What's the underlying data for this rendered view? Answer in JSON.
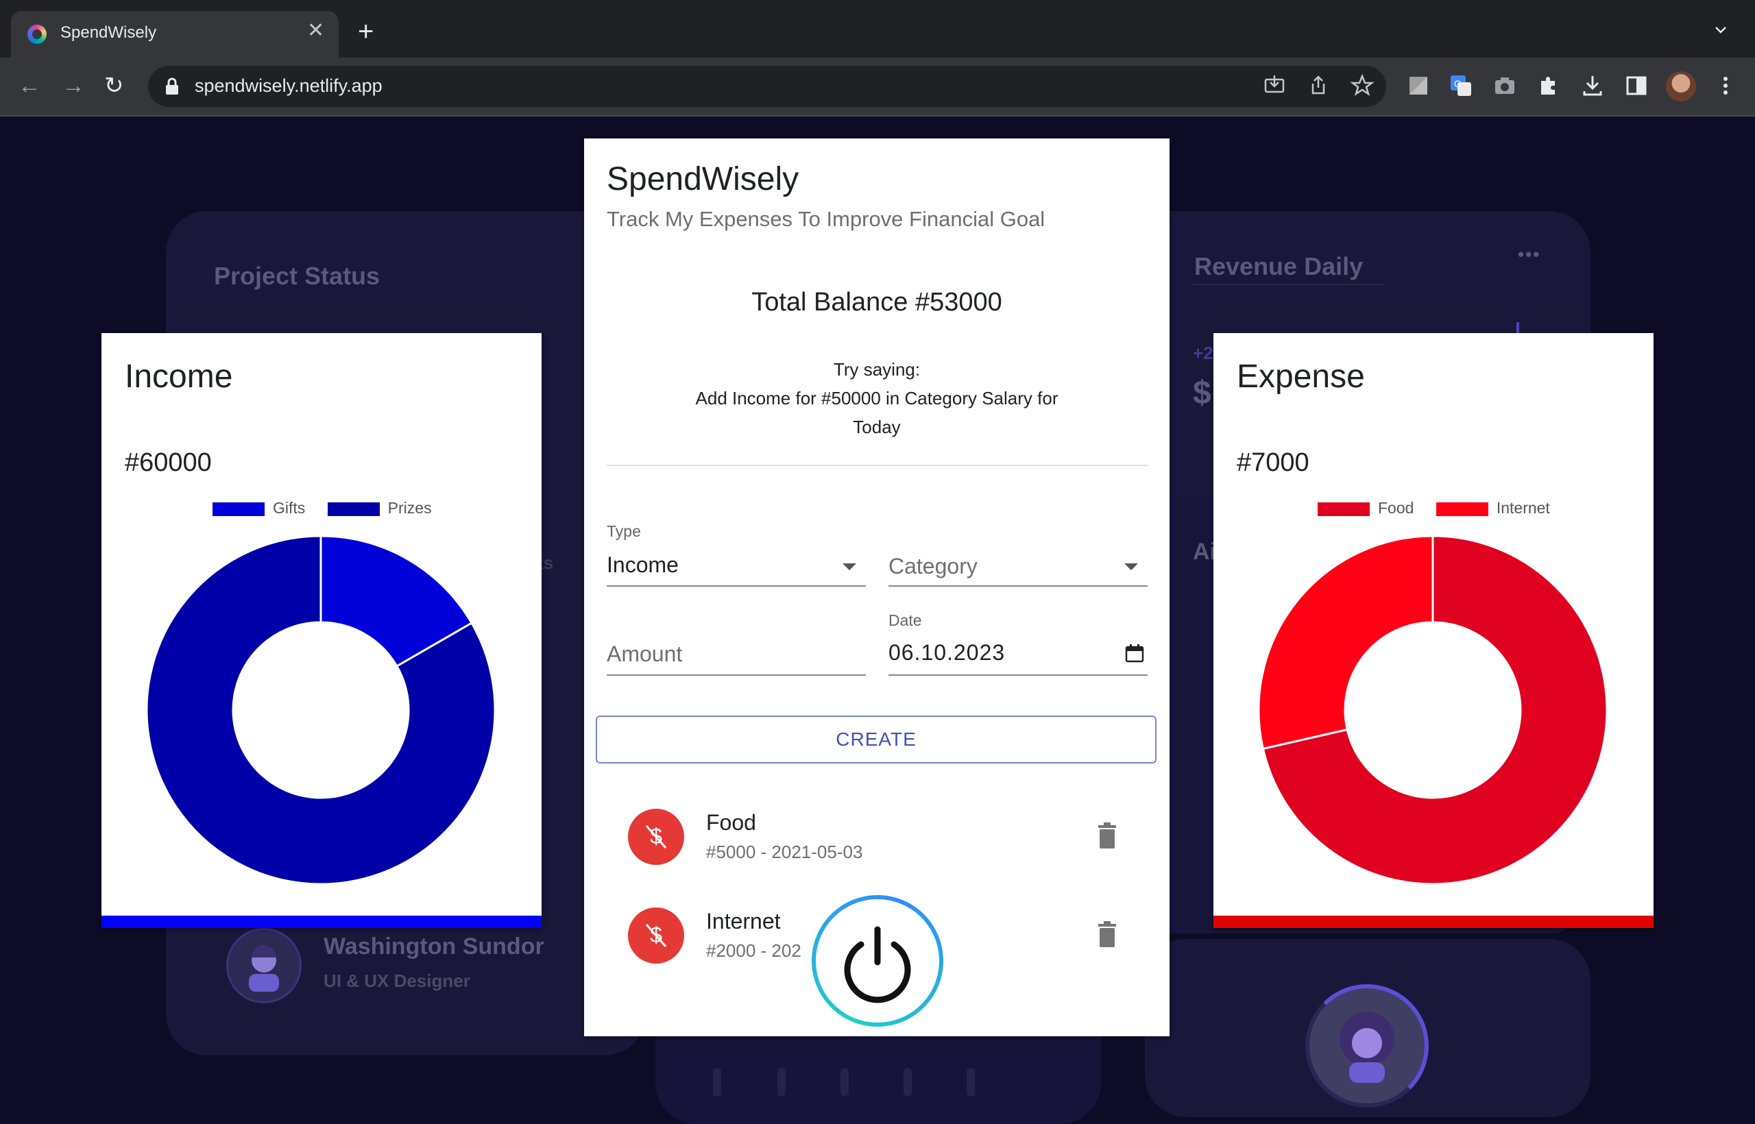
{
  "browser": {
    "tab_title": "SpendWisely",
    "tab_close": "✕",
    "new_tab": "+",
    "url": "spendwisely.netlify.app",
    "nav": {
      "back": "←",
      "forward": "→",
      "reload": "↻"
    }
  },
  "background": {
    "project_status": "Project Status",
    "revenue_daily": "Revenue Daily",
    "more": "•••",
    "partial_plus": "+2",
    "partial_dollar": "$",
    "partial_ai": "Ai",
    "partial_ts": "ts",
    "person_name": "Washington Sundor",
    "person_role": "UI & UX Designer"
  },
  "income": {
    "title": "Income",
    "amount": "#60000",
    "legend": [
      "Gifts",
      "Prizes"
    ],
    "accent": "#0000ff"
  },
  "expense": {
    "title": "Expense",
    "amount": "#7000",
    "legend": [
      "Food",
      "Internet"
    ],
    "accent": "#e00000"
  },
  "main": {
    "title": "SpendWisely",
    "subtitle": "Track My Expenses To Improve Financial Goal",
    "balance": "Total Balance #53000",
    "hint_line1": "Try saying:",
    "hint_line2": "Add Income for #50000 in Category Salary for",
    "hint_line3": "Today",
    "type_label": "Type",
    "type_value": "Income",
    "category_placeholder": "Category",
    "amount_placeholder": "Amount",
    "date_label": "Date",
    "date_value": "06.10.2023",
    "create_label": "CREATE",
    "transactions": [
      {
        "title": "Food",
        "subtitle": "#5000 - 2021-05-03"
      },
      {
        "title": "Internet",
        "subtitle": "#2000 - 202"
      }
    ]
  },
  "chart_data": [
    {
      "type": "pie",
      "title": "Income",
      "categories": [
        "Gifts",
        "Prizes"
      ],
      "values": [
        10000,
        50000
      ],
      "colors": [
        "#0000d9",
        "#0000a8"
      ],
      "legend": "top"
    },
    {
      "type": "pie",
      "title": "Expense",
      "categories": [
        "Food",
        "Internet"
      ],
      "values": [
        5000,
        2000
      ],
      "colors": [
        "#e0001f",
        "#ff0014"
      ],
      "legend": "top"
    }
  ]
}
